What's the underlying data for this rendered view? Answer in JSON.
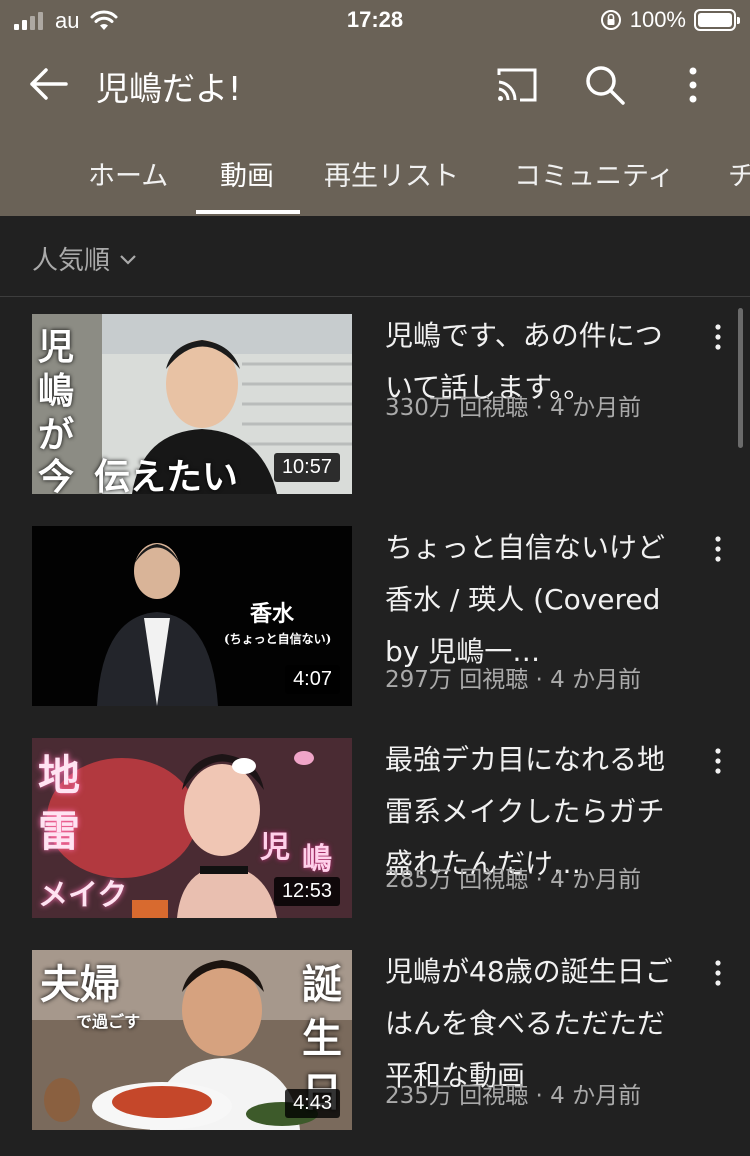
{
  "status_bar": {
    "carrier": "au",
    "time": "17:28",
    "battery": "100%"
  },
  "app_bar": {
    "title": "児嶋だよ!",
    "icons": [
      "back-arrow-icon",
      "cast-icon",
      "search-icon",
      "more-vert-icon"
    ]
  },
  "tabs": [
    "ホーム",
    "動画",
    "再生リスト",
    "コミュニティ",
    "チ"
  ],
  "active_tab": "動画",
  "sort": {
    "label": "人気順"
  },
  "videos": [
    {
      "title": "児嶋です、あの件について話します。。",
      "views": "330万 回視聴",
      "age": "4 か月前",
      "duration": "10:57",
      "thumb_text": [
        "児",
        "嶋",
        "が",
        "今",
        "伝えたい"
      ]
    },
    {
      "title": "ちょっと自信ないけど香水 / 瑛人 (Covered by 児嶋一…",
      "views": "297万 回視聴",
      "age": "4 か月前",
      "duration": "4:07",
      "thumb_text": [
        "香水",
        "(ちょっと自信ない)"
      ]
    },
    {
      "title": "最強デカ目になれる地雷系メイクしたらガチ盛れたんだけ…",
      "views": "285万 回視聴",
      "age": "4 か月前",
      "duration": "12:53",
      "thumb_text": [
        "地",
        "雷",
        "メイク",
        "児",
        "嶋"
      ]
    },
    {
      "title": "児嶋が48歳の誕生日ごはんを食べるただただ平和な動画",
      "views": "235万 回視聴",
      "age": "4 か月前",
      "duration": "4:43",
      "thumb_text": [
        "夫婦",
        "で過ごす",
        "誕",
        "生",
        "日"
      ]
    }
  ],
  "colors": {
    "header": "#6a6257",
    "background": "#212121",
    "text_primary": "#f1f1f1",
    "text_secondary": "#aaaaaa"
  }
}
